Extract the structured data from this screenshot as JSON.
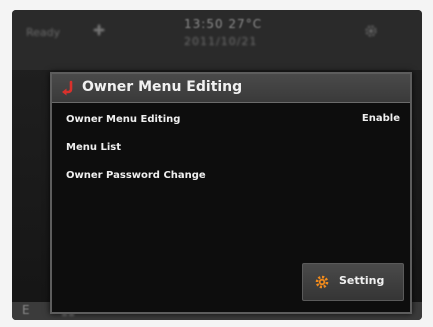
{
  "background": {
    "top_left_label": "Ready",
    "clock": "13:50",
    "temperature": "27°C",
    "date": "2011/10/21",
    "bottom_label": "E"
  },
  "dialog": {
    "title": "Owner Menu Editing",
    "items": [
      {
        "label": "Owner Menu Editing",
        "value": "Enable"
      },
      {
        "label": "Menu List",
        "value": ""
      },
      {
        "label": "Owner Password Change",
        "value": ""
      }
    ],
    "setting_button_label": "Setting"
  },
  "colors": {
    "accent_back_icon": "#d9312c",
    "accent_gear": "#f08a1c",
    "dialog_bg": "#0d0d0d",
    "title_bar": "#404040"
  },
  "icons": {
    "back": "return-arrow-icon",
    "setting": "gear-icon",
    "fan": "fan-icon",
    "bg_gear": "gear-icon"
  }
}
